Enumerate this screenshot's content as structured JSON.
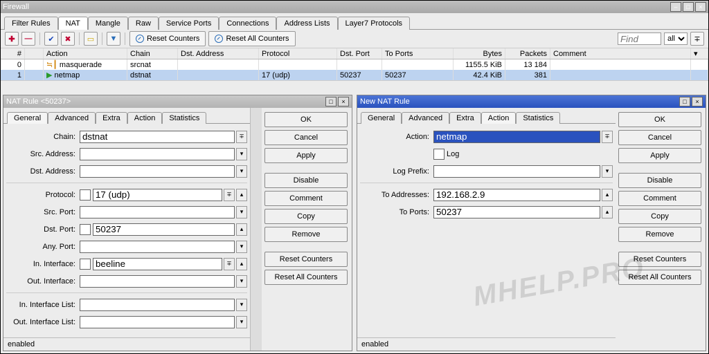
{
  "window": {
    "title": "Firewall"
  },
  "tabs": [
    "Filter Rules",
    "NAT",
    "Mangle",
    "Raw",
    "Service Ports",
    "Connections",
    "Address Lists",
    "Layer7 Protocols"
  ],
  "tabs_active": 1,
  "toolbar": {
    "reset_counters": "Reset Counters",
    "reset_all_counters": "Reset All Counters",
    "find_placeholder": "Find",
    "filter_all": "all"
  },
  "grid": {
    "headers": {
      "num": "#",
      "action": "Action",
      "chain": "Chain",
      "dst": "Dst. Address",
      "proto": "Protocol",
      "dport": "Dst. Port",
      "toports": "To Ports",
      "bytes": "Bytes",
      "packets": "Packets",
      "comment": "Comment"
    },
    "rows": [
      {
        "num": "0",
        "action": "masquerade",
        "chain": "srcnat",
        "dst": "",
        "proto": "",
        "dport": "",
        "toports": "",
        "bytes": "1155.5 KiB",
        "packets": "13 184",
        "comment": "",
        "selected": false,
        "icon": "masq"
      },
      {
        "num": "1",
        "action": "netmap",
        "chain": "dstnat",
        "dst": "",
        "proto": "17 (udp)",
        "dport": "50237",
        "toports": "50237",
        "bytes": "42.4 KiB",
        "packets": "381",
        "comment": "",
        "selected": true,
        "icon": "netmap"
      }
    ]
  },
  "panelL": {
    "title": "NAT Rule <50237>",
    "tabs": [
      "General",
      "Advanced",
      "Extra",
      "Action",
      "Statistics"
    ],
    "tabs_active": 0,
    "fields": {
      "chain": "dstnat",
      "src_address": "",
      "dst_address": "",
      "protocol": "17 (udp)",
      "src_port": "",
      "dst_port": "50237",
      "any_port": "",
      "in_interface": "beeline",
      "out_interface": "",
      "in_if_list": "",
      "out_if_list": ""
    },
    "status": "enabled"
  },
  "panelR": {
    "title": "New NAT Rule",
    "tabs": [
      "General",
      "Advanced",
      "Extra",
      "Action",
      "Statistics"
    ],
    "tabs_active": 3,
    "fields": {
      "action": "netmap",
      "log": false,
      "log_prefix": "",
      "to_addresses": "192.168.2.9",
      "to_ports": "50237"
    },
    "status": "enabled"
  },
  "labels": {
    "chain": "Chain:",
    "src_address": "Src. Address:",
    "dst_address": "Dst. Address:",
    "protocol": "Protocol:",
    "src_port": "Src. Port:",
    "dst_port": "Dst. Port:",
    "any_port": "Any. Port:",
    "in_interface": "In. Interface:",
    "out_interface": "Out. Interface:",
    "in_if_list": "In. Interface List:",
    "out_if_list": "Out. Interface List:",
    "action": "Action:",
    "log": "Log",
    "log_prefix": "Log Prefix:",
    "to_addresses": "To Addresses:",
    "to_ports": "To Ports:"
  },
  "buttons": {
    "ok": "OK",
    "cancel": "Cancel",
    "apply": "Apply",
    "disable": "Disable",
    "comment": "Comment",
    "copy": "Copy",
    "remove": "Remove",
    "reset_counters": "Reset Counters",
    "reset_all_counters": "Reset All Counters"
  },
  "watermark": "MHELP.PRO"
}
